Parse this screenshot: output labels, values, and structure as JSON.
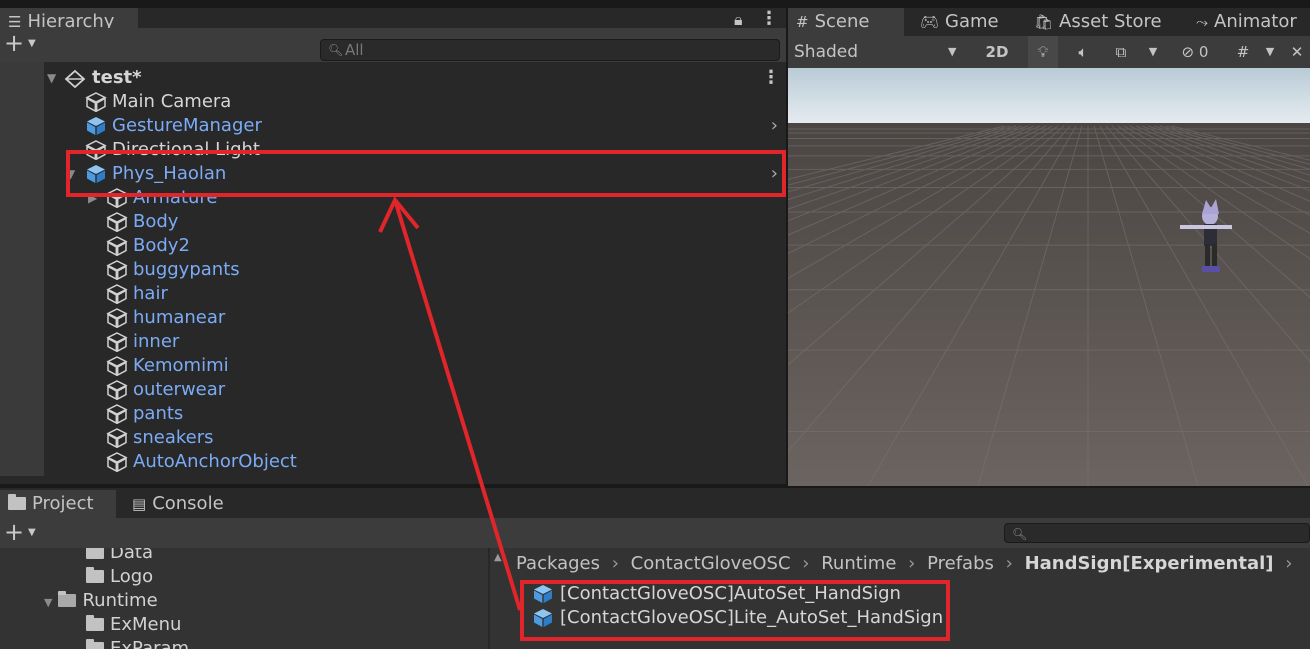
{
  "hierarchy": {
    "tab_label": "Hierarchy",
    "search_placeholder": "All",
    "scene_name": "test*",
    "items": [
      {
        "label": "Main Camera",
        "color": "white"
      },
      {
        "label": "GestureManager",
        "color": "blue"
      },
      {
        "label": "Directional Light",
        "color": "white"
      },
      {
        "label": "Phys_Haolan",
        "color": "blue"
      },
      {
        "label": "Armature",
        "color": "blue"
      },
      {
        "label": "Body",
        "color": "blue"
      },
      {
        "label": "Body2",
        "color": "blue"
      },
      {
        "label": "buggypants",
        "color": "blue"
      },
      {
        "label": "hair",
        "color": "blue"
      },
      {
        "label": "humanear",
        "color": "blue"
      },
      {
        "label": "inner",
        "color": "blue"
      },
      {
        "label": "Kemomimi",
        "color": "blue"
      },
      {
        "label": "outerwear",
        "color": "blue"
      },
      {
        "label": "pants",
        "color": "blue"
      },
      {
        "label": "sneakers",
        "color": "blue"
      },
      {
        "label": "AutoAnchorObject",
        "color": "blue"
      }
    ]
  },
  "scene": {
    "tabs": [
      "Scene",
      "Game",
      "Asset Store",
      "Animator"
    ],
    "shading_mode": "Shaded",
    "mode_2d": "2D",
    "hidden_count": "0"
  },
  "project": {
    "tabs": [
      "Project",
      "Console"
    ],
    "tree": [
      "Data",
      "Logo",
      "Runtime",
      "ExMenu",
      "ExParam"
    ],
    "breadcrumb": [
      "Packages",
      "ContactGloveOSC",
      "Runtime",
      "Prefabs",
      "HandSign[Experimental]"
    ],
    "assets": [
      "[ContactGloveOSC]AutoSet_HandSign",
      "[ContactGloveOSC]Lite_AutoSet_HandSign"
    ]
  },
  "colors": {
    "annotation_red": "#e0252b",
    "prefab_blue": "#7cabf5",
    "panel_bg": "#282828",
    "toolbar_bg": "#3c3c3c"
  }
}
